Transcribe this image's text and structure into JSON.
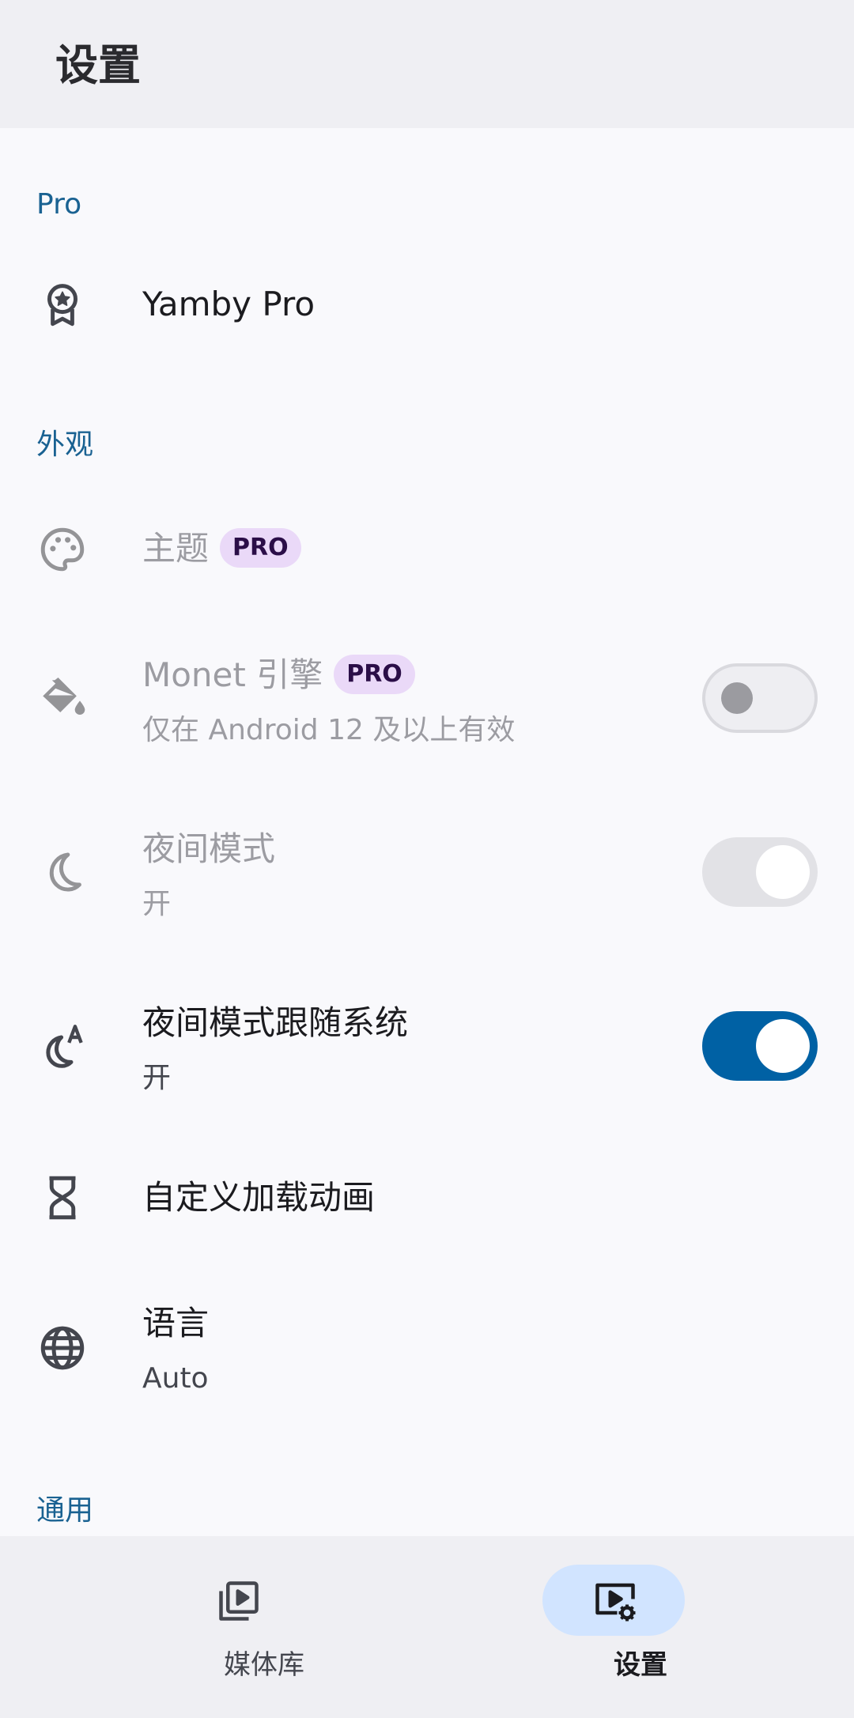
{
  "header": {
    "title": "设置"
  },
  "sections": {
    "pro": "Pro",
    "appearance": "外观",
    "general": "通用"
  },
  "items": {
    "yamby_pro": {
      "title": "Yamby Pro"
    },
    "theme": {
      "title": "主题",
      "badge": "PRO"
    },
    "monet": {
      "title": "Monet 引擎",
      "badge": "PRO",
      "subtitle": "仅在 Android 12 及以上有效",
      "enabled": false
    },
    "night_mode": {
      "title": "夜间模式",
      "subtitle": "开",
      "enabled": true
    },
    "night_follow": {
      "title": "夜间模式跟随系统",
      "subtitle": "开",
      "enabled": true
    },
    "loading_anim": {
      "title": "自定义加载动画"
    },
    "language": {
      "title": "语言",
      "subtitle": "Auto"
    }
  },
  "nav": {
    "library": "媒体库",
    "settings": "设置"
  },
  "colors": {
    "accent": "#0061a4",
    "section_header": "#1a6292",
    "pro_badge_bg": "#ead9f8"
  }
}
